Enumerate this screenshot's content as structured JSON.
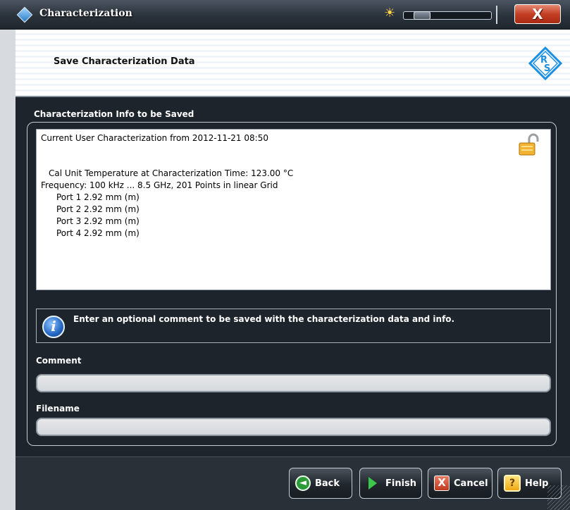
{
  "window": {
    "title": "Characterization",
    "close_label": "X",
    "brightness_level": 0.1
  },
  "header": {
    "title": "Save Characterization Data"
  },
  "info_section": {
    "title": "Characterization Info to be Saved",
    "header_line": "Current User Characterization from 2012-11-21 08:50",
    "details": [
      "Cal Unit Temperature at Characterization Time: 123.00 °C",
      "Frequency: 100 kHz ... 8.5 GHz, 201 Points in linear Grid"
    ],
    "ports": [
      "Port 1 2.92 mm (m)",
      "Port 2 2.92 mm (m)",
      "Port 3 2.92 mm (m)",
      "Port 4 2.92 mm (m)"
    ],
    "lock_state": "unlocked"
  },
  "hint": {
    "icon": "info-icon",
    "icon_glyph": "i",
    "text": "Enter an optional comment to be saved with the characterization data and info."
  },
  "comment": {
    "label": "Comment",
    "value": ""
  },
  "filename": {
    "label": "Filename",
    "value": ""
  },
  "buttons": {
    "back": "Back",
    "finish": "Finish",
    "cancel": "Cancel",
    "help": "Help",
    "back_glyph": "◄",
    "cancel_glyph": "X",
    "help_glyph": "?"
  },
  "colors": {
    "accent": "#2a7cc7",
    "dialog_bg": "#1e242b",
    "close_red": "#c43f24"
  }
}
